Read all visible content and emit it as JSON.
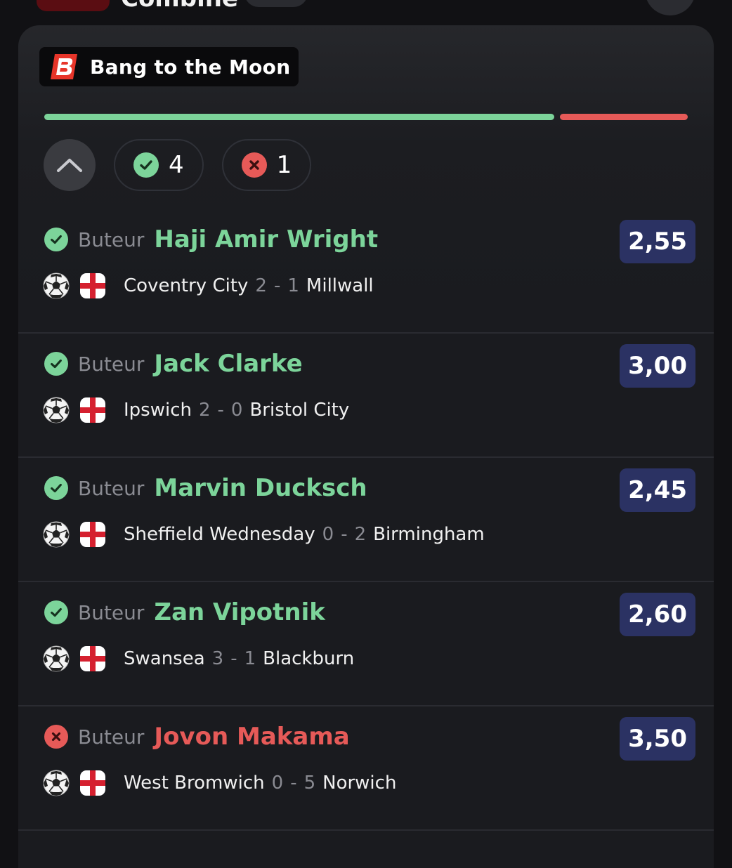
{
  "header": {
    "title": "Combiné"
  },
  "ticket": {
    "brand_name": "Bang to the Moon",
    "progress": {
      "won": 4,
      "lost": 1
    },
    "summary": {
      "won_count": "4",
      "lost_count": "1"
    },
    "colors": {
      "win": "#7cd49a",
      "loss": "#e65a58",
      "odds_bg": "#2b3263"
    }
  },
  "bets": [
    {
      "type": "Buteur",
      "player": "Haji Amir Wright",
      "status": "won",
      "odds": "2,55",
      "home": "Coventry City",
      "home_score": "2",
      "separator": "-",
      "away_score": "1",
      "away": "Millwall",
      "sport_icon": "soccer-ball-icon",
      "country_icon": "england-flag-icon"
    },
    {
      "type": "Buteur",
      "player": "Jack Clarke",
      "status": "won",
      "odds": "3,00",
      "home": "Ipswich",
      "home_score": "2",
      "separator": "-",
      "away_score": "0",
      "away": "Bristol City",
      "sport_icon": "soccer-ball-icon",
      "country_icon": "england-flag-icon"
    },
    {
      "type": "Buteur",
      "player": "Marvin Ducksch",
      "status": "won",
      "odds": "2,45",
      "home": "Sheffield Wednesday",
      "home_score": "0",
      "separator": "-",
      "away_score": "2",
      "away": "Birmingham",
      "sport_icon": "soccer-ball-icon",
      "country_icon": "england-flag-icon"
    },
    {
      "type": "Buteur",
      "player": "Zan Vipotnik",
      "status": "won",
      "odds": "2,60",
      "home": "Swansea",
      "home_score": "3",
      "separator": "-",
      "away_score": "1",
      "away": "Blackburn",
      "sport_icon": "soccer-ball-icon",
      "country_icon": "england-flag-icon"
    },
    {
      "type": "Buteur",
      "player": "Jovon Makama",
      "status": "lost",
      "odds": "3,50",
      "home": "West Bromwich",
      "home_score": "0",
      "separator": "-",
      "away_score": "5",
      "away": "Norwich",
      "sport_icon": "soccer-ball-icon",
      "country_icon": "england-flag-icon"
    }
  ]
}
